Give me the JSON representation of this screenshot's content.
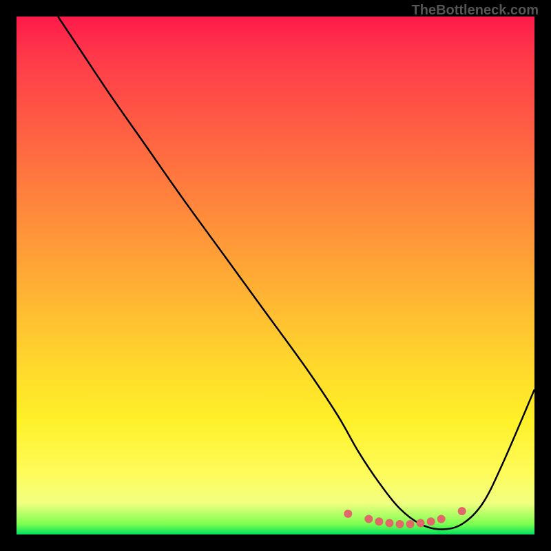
{
  "watermark": "TheBottleneck.com",
  "chart_data": {
    "type": "line",
    "title": "",
    "xlabel": "",
    "ylabel": "",
    "xlim": [
      0,
      100
    ],
    "ylim": [
      0,
      100
    ],
    "grid": false,
    "legend": false,
    "series": [
      {
        "name": "bottleneck-curve",
        "x": [
          8,
          12,
          18,
          25,
          32,
          40,
          48,
          56,
          62,
          66,
          70,
          74,
          78,
          82,
          86,
          90,
          94,
          100
        ],
        "values": [
          100,
          94,
          85,
          75,
          65,
          54,
          43,
          32,
          23,
          16,
          10,
          5,
          2,
          1,
          2,
          6,
          14,
          28
        ]
      }
    ],
    "dots": {
      "name": "highlight-dots",
      "x": [
        64,
        68,
        70,
        72,
        74,
        76,
        78,
        80,
        82,
        86
      ],
      "values": [
        4,
        3,
        2.5,
        2.2,
        2,
        2,
        2.2,
        2.5,
        3,
        4.5
      ],
      "color": "#e06868"
    },
    "colors": {
      "curve": "#000000",
      "dots": "#e06868",
      "gradient_top": "#ff1a4a",
      "gradient_mid": "#ffda2c",
      "gradient_bottom": "#00e060",
      "frame": "#000000"
    }
  }
}
